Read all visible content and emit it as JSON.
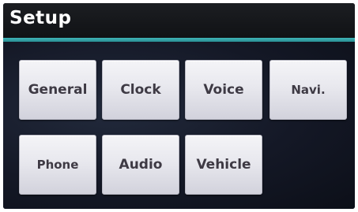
{
  "header": {
    "title": "Setup"
  },
  "menu": {
    "buttons": [
      {
        "label": "General"
      },
      {
        "label": "Clock"
      },
      {
        "label": "Voice"
      },
      {
        "label": "Navi."
      },
      {
        "label": "Phone"
      },
      {
        "label": "Audio"
      },
      {
        "label": "Vehicle"
      }
    ]
  },
  "colors": {
    "accent": "#3fb4b8",
    "background": "#0a0c10",
    "button_face": "#e8e8ee",
    "button_text": "#3e3a44"
  }
}
